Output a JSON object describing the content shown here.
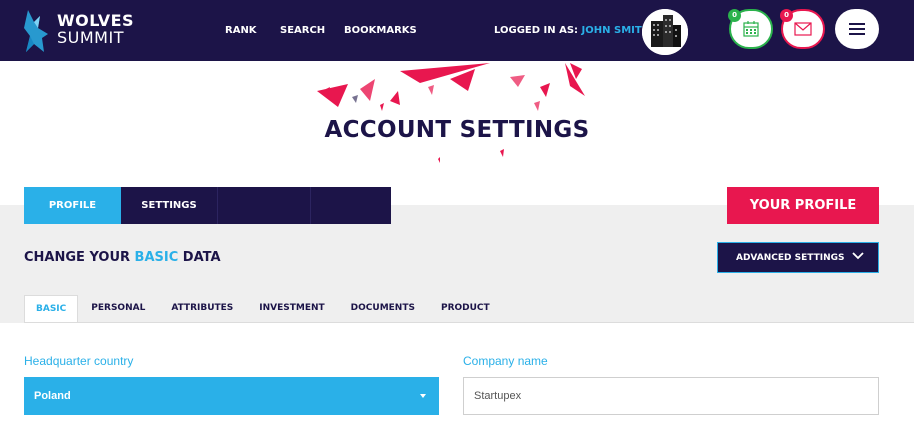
{
  "brand": {
    "line1": "WOLVES",
    "line2": "SUMMIT"
  },
  "nav": [
    {
      "label": "RANK"
    },
    {
      "label": "SEARCH"
    },
    {
      "label": "BOOKMARKS"
    }
  ],
  "user": {
    "logged_prefix": "LOGGED IN AS:",
    "name": "JOHN SMITH"
  },
  "notifications": {
    "calendar_count": "0",
    "messages_count": "0"
  },
  "hero": {
    "title": "ACCOUNT SETTINGS"
  },
  "main_tabs": [
    {
      "label": "PROFILE",
      "active": true
    },
    {
      "label": "SETTINGS",
      "active": false
    },
    {
      "label": "",
      "active": false
    },
    {
      "label": "",
      "active": false
    }
  ],
  "your_profile_button": "YOUR PROFILE",
  "section": {
    "title_pre": "CHANGE YOUR ",
    "title_hl": "BASIC",
    "title_post": " DATA"
  },
  "advanced_settings": "ADVANCED SETTINGS",
  "sub_tabs": [
    {
      "label": "BASIC",
      "active": true
    },
    {
      "label": "PERSONAL",
      "active": false
    },
    {
      "label": "ATTRIBUTES",
      "active": false
    },
    {
      "label": "INVESTMENT",
      "active": false
    },
    {
      "label": "DOCUMENTS",
      "active": false
    },
    {
      "label": "PRODUCT",
      "active": false
    }
  ],
  "form": {
    "hq_country_label": "Headquarter country",
    "hq_country_value": "Poland",
    "company_name_label": "Company name",
    "company_name_value": "Startupex"
  },
  "colors": {
    "navy": "#1c1448",
    "accent_blue": "#2ab0e8",
    "accent_red": "#e8174f",
    "green": "#2bb24c"
  }
}
